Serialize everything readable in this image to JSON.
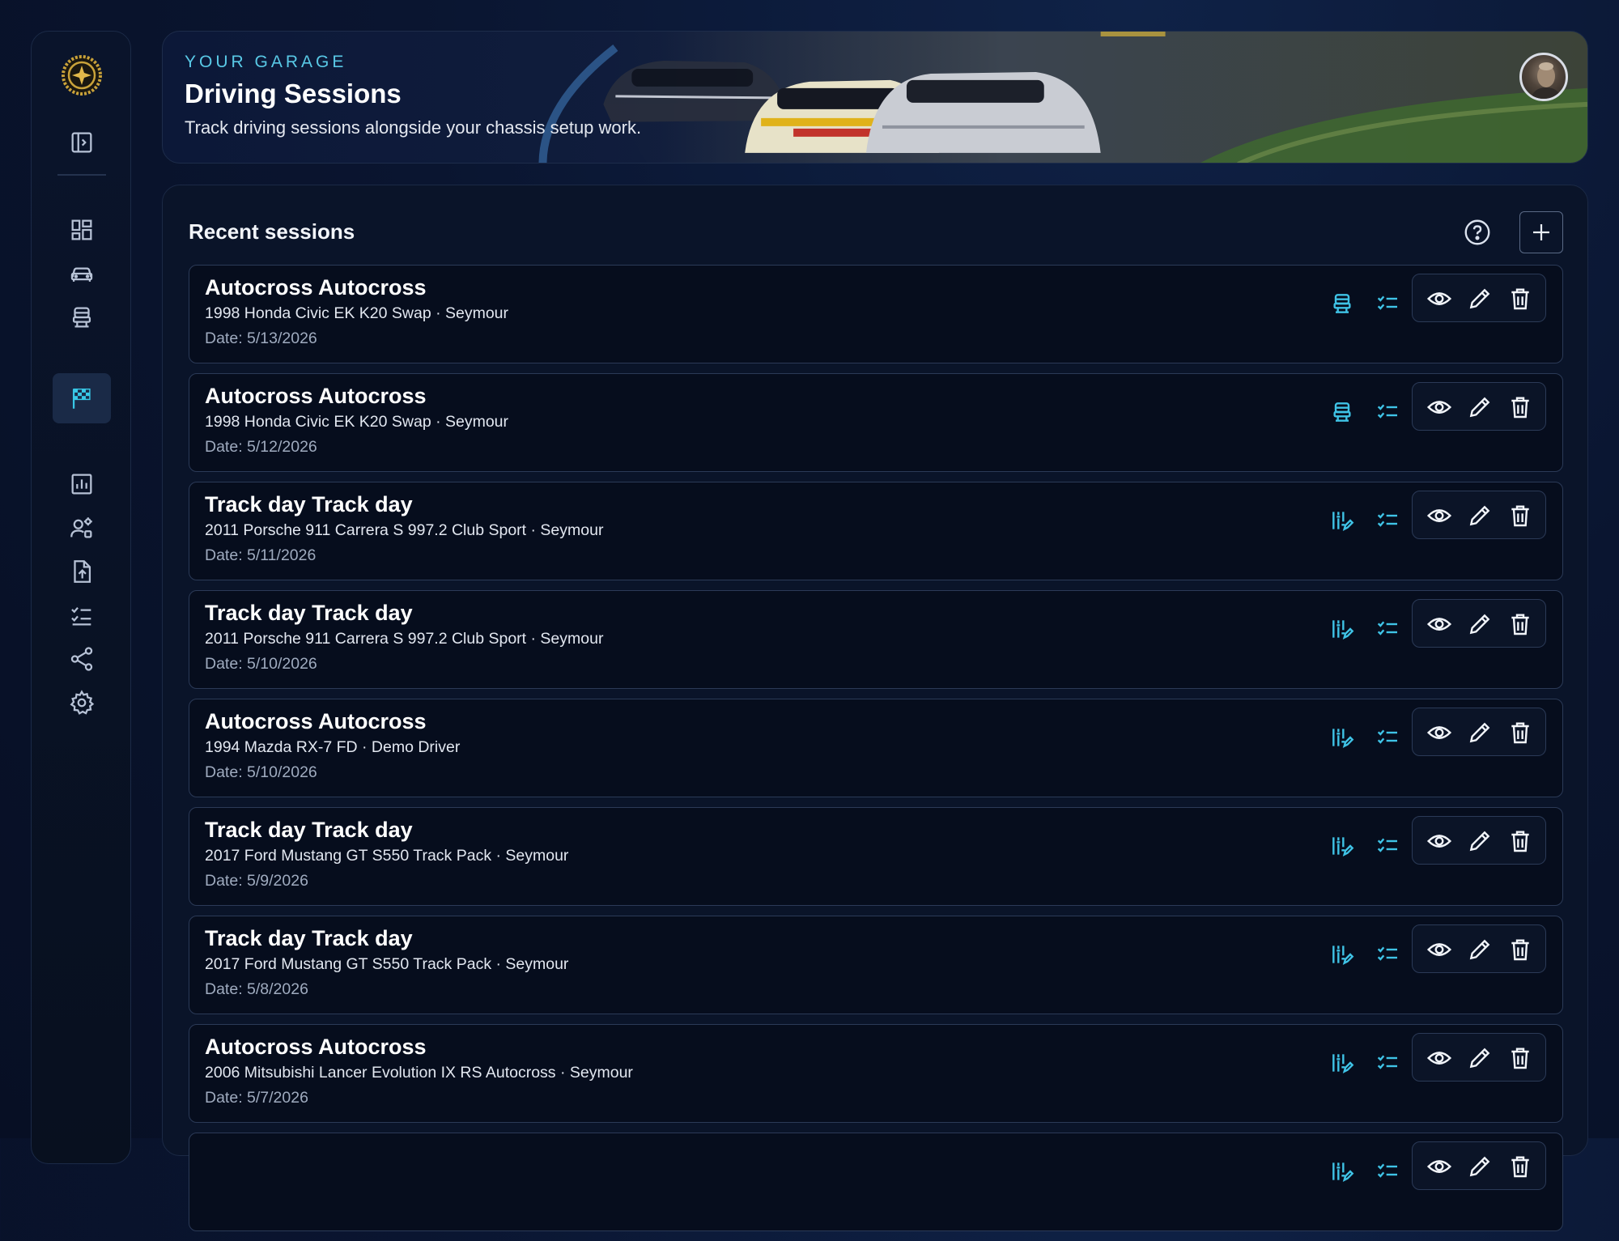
{
  "header": {
    "eyebrow": "YOUR GARAGE",
    "title": "Driving Sessions",
    "subtitle": "Track driving sessions alongside your chassis setup work."
  },
  "sidebar": {
    "items": [
      {
        "name": "dashboard",
        "icon": "dashboard-icon"
      },
      {
        "name": "cars",
        "icon": "car-icon"
      },
      {
        "name": "seat",
        "icon": "seat-icon"
      },
      {
        "name": "sessions",
        "icon": "checkered-flag-icon",
        "active": true
      },
      {
        "name": "reports",
        "icon": "chart-icon"
      },
      {
        "name": "drivers",
        "icon": "driver-settings-icon"
      },
      {
        "name": "export",
        "icon": "file-upload-icon"
      },
      {
        "name": "checklists",
        "icon": "checklist-icon"
      },
      {
        "name": "share",
        "icon": "share-icon"
      },
      {
        "name": "settings",
        "icon": "gear-icon"
      }
    ]
  },
  "panel": {
    "title": "Recent sessions"
  },
  "sessions": [
    {
      "title": "Autocross Autocross",
      "car": "1998 Honda Civic EK K20 Swap · Seymour",
      "date": "Date: 5/13/2026",
      "type_icon": "seat-icon"
    },
    {
      "title": "Autocross Autocross",
      "car": "1998 Honda Civic EK K20 Swap · Seymour",
      "date": "Date: 5/12/2026",
      "type_icon": "seat-icon"
    },
    {
      "title": "Track day Track day",
      "car": "2011 Porsche 911 Carrera S 997.2 Club Sport · Seymour",
      "date": "Date: 5/11/2026",
      "type_icon": "setup-edit-icon"
    },
    {
      "title": "Track day Track day",
      "car": "2011 Porsche 911 Carrera S 997.2 Club Sport · Seymour",
      "date": "Date: 5/10/2026",
      "type_icon": "setup-edit-icon"
    },
    {
      "title": "Autocross Autocross",
      "car": "1994 Mazda RX-7 FD · Demo Driver",
      "date": "Date: 5/10/2026",
      "type_icon": "setup-edit-icon"
    },
    {
      "title": "Track day Track day",
      "car": "2017 Ford Mustang GT S550 Track Pack · Seymour",
      "date": "Date: 5/9/2026",
      "type_icon": "setup-edit-icon"
    },
    {
      "title": "Track day Track day",
      "car": "2017 Ford Mustang GT S550 Track Pack · Seymour",
      "date": "Date: 5/8/2026",
      "type_icon": "setup-edit-icon"
    },
    {
      "title": "Autocross Autocross",
      "car": "2006 Mitsubishi Lancer Evolution IX RS Autocross · Seymour",
      "date": "Date: 5/7/2026",
      "type_icon": "setup-edit-icon"
    },
    {
      "title": "",
      "car": "",
      "date": "",
      "type_icon": "setup-edit-icon"
    }
  ],
  "colors": {
    "accent": "#3fc3e6",
    "active_bg": "#1a2a47",
    "gold": "#c9a23a"
  }
}
